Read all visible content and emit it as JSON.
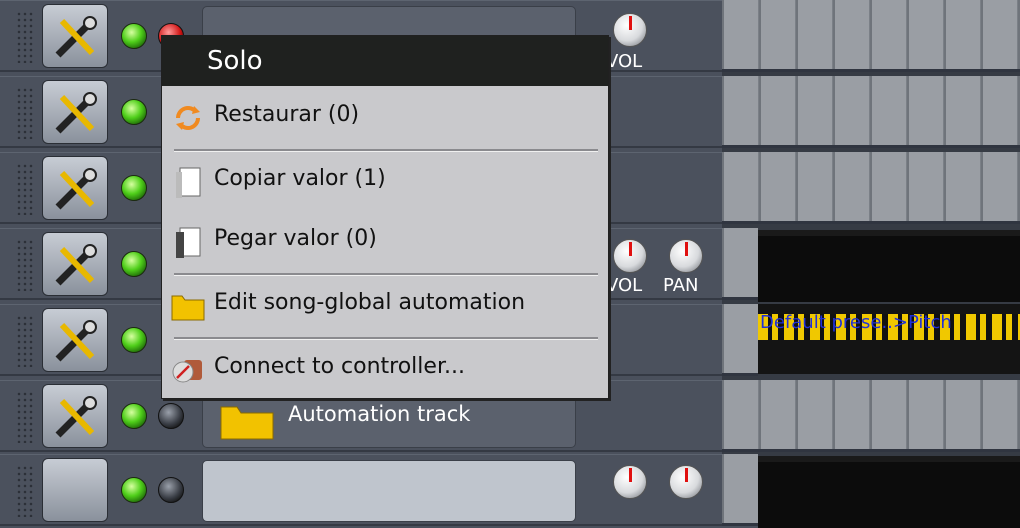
{
  "tracks": [
    {
      "name": ""
    },
    {
      "name": ""
    },
    {
      "name": ""
    },
    {
      "name": ""
    },
    {
      "name": ""
    },
    {
      "name": "Automation track"
    },
    {
      "name": ""
    }
  ],
  "knobs": {
    "vol": "VOL",
    "pan": "PAN"
  },
  "clip": {
    "label": "Default prese..>Pitch"
  },
  "context_menu": {
    "title": "Solo",
    "items": [
      {
        "label": "Restaurar (0)",
        "icon": "reload-icon"
      },
      {
        "label": "Copiar valor (1)",
        "icon": "copy-icon"
      },
      {
        "label": "Pegar valor (0)",
        "icon": "paste-icon"
      },
      {
        "label": "Edit song-global automation",
        "icon": "folder-icon"
      },
      {
        "label": "Connect to controller...",
        "icon": "controller-icon"
      }
    ]
  },
  "colors": {
    "menu_bg": "#c9c9cc",
    "menu_title_bg": "#1f211f",
    "led_green": "#4fcf1a",
    "solo_red": "#d01414",
    "clip_yellow": "#f0c800"
  }
}
